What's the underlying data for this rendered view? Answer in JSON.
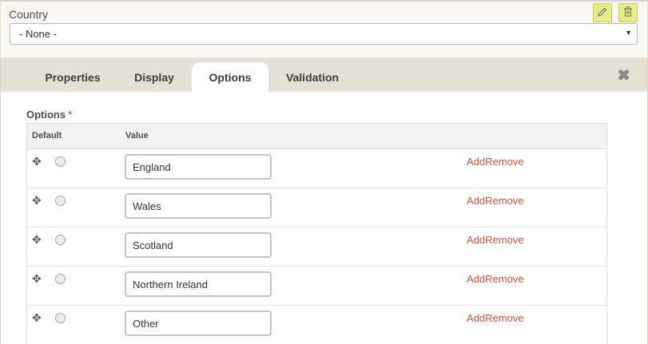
{
  "field": {
    "label": "Country",
    "select_value": "- None -",
    "select_arrow": "▼",
    "edit_icon": "pencil-icon",
    "delete_icon": "trash-icon"
  },
  "tabs": [
    {
      "label": "Properties"
    },
    {
      "label": "Display"
    },
    {
      "label": "Options",
      "active": true
    },
    {
      "label": "Validation"
    }
  ],
  "close_icon": "✖",
  "options": {
    "label": "Options",
    "required_mark": "*",
    "columns": {
      "default": "Default",
      "value": "Value"
    },
    "add_label": "Add",
    "remove_label": "Remove",
    "rows": [
      {
        "value": "England"
      },
      {
        "value": "Wales"
      },
      {
        "value": "Scotland"
      },
      {
        "value": "Northern Ireland"
      },
      {
        "value": "Other"
      }
    ]
  },
  "colors": {
    "accent_button": "#e6ec8b",
    "link": "#c8553d",
    "tab_bar": "#e6e1d6"
  }
}
